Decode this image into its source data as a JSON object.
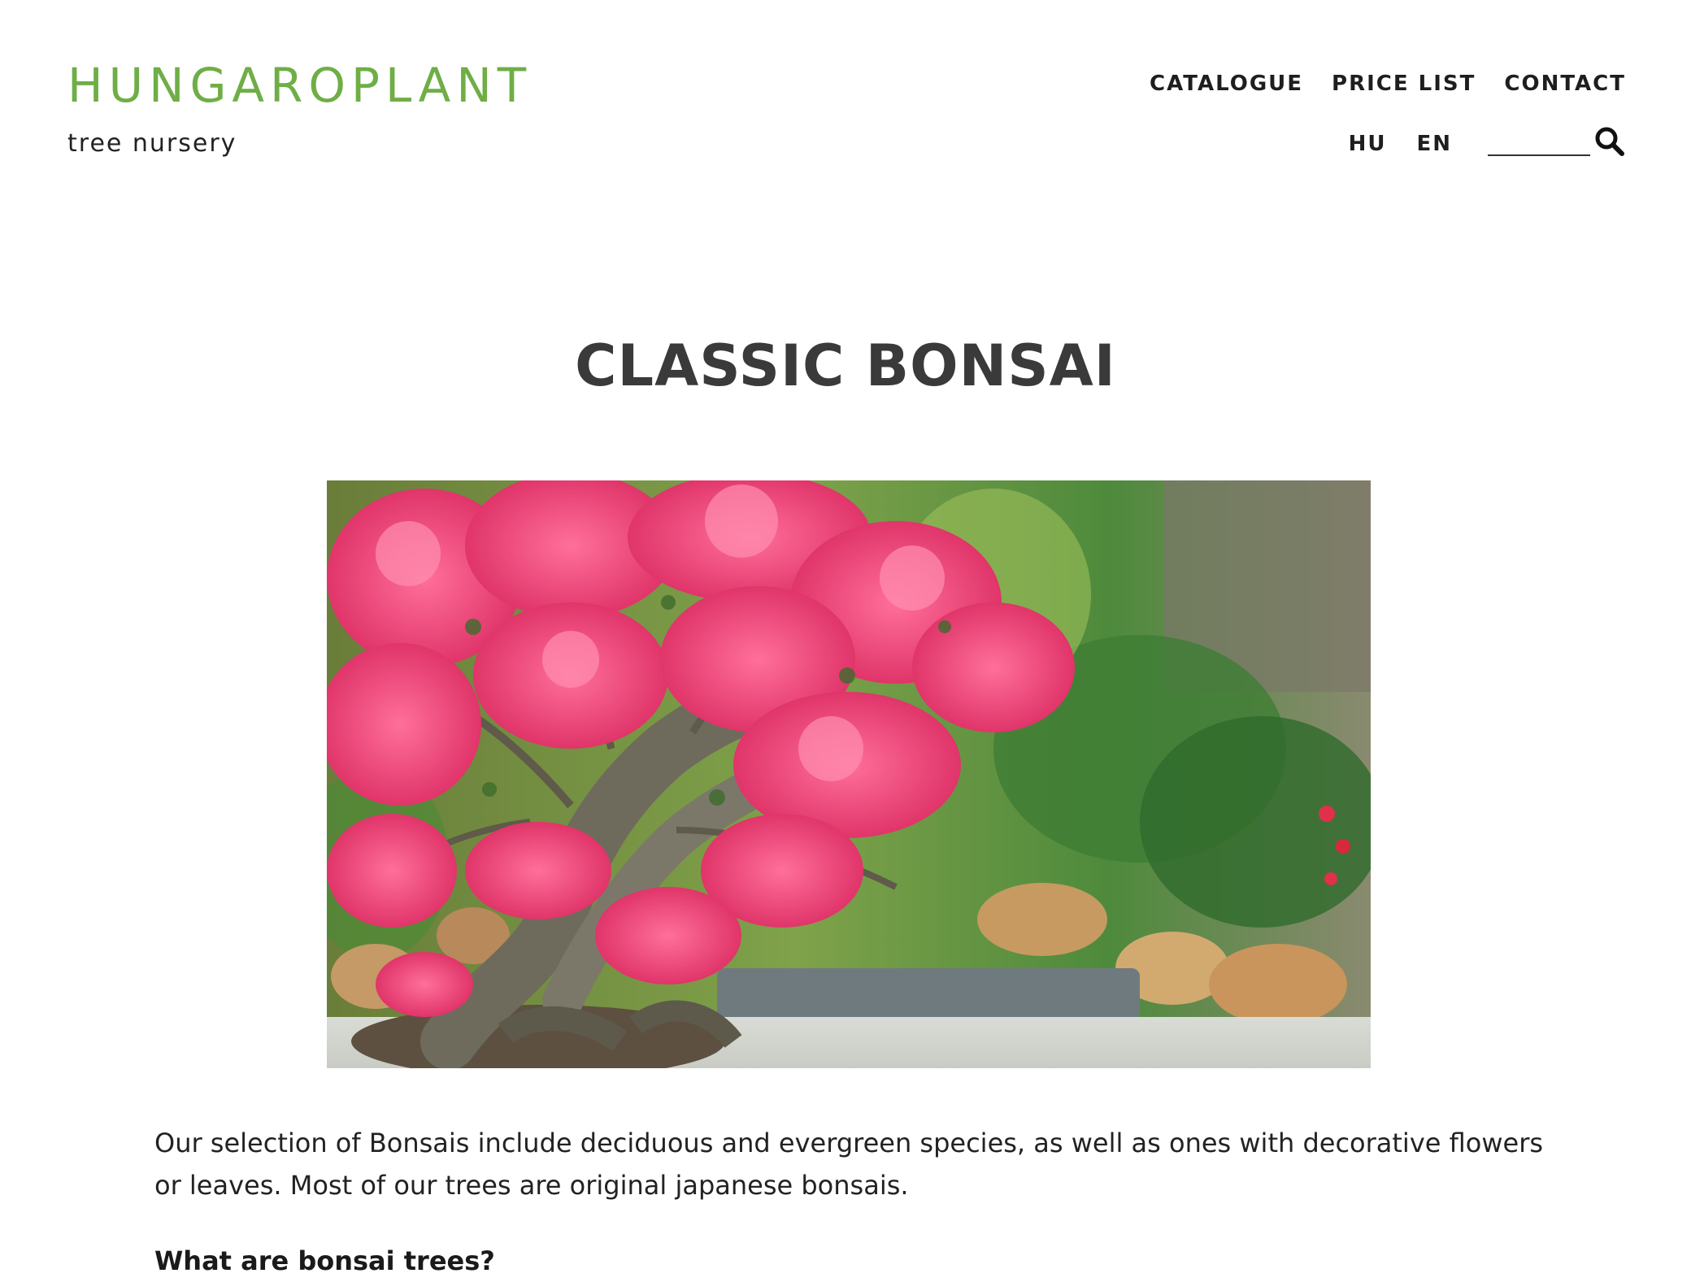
{
  "brand": {
    "name": "HUNGAROPLANT",
    "tagline": "tree nursery",
    "color": "#6fae46"
  },
  "nav": {
    "items": [
      {
        "label": "CATALOGUE"
      },
      {
        "label": "PRICE LIST"
      },
      {
        "label": "CONTACT"
      }
    ],
    "languages": [
      {
        "label": "HU"
      },
      {
        "label": "EN"
      }
    ],
    "search": {
      "value": "",
      "placeholder": "",
      "icon": "search-icon"
    }
  },
  "page": {
    "title": "CLASSIC BONSAI",
    "hero_image": "flowering-bonsai-photo",
    "intro": "Our selection of Bonsais include deciduous and evergreen species, as well as ones with decorative flowers or leaves. Most of our trees are original japanese bonsais.",
    "subheading": "What are bonsai trees?"
  }
}
